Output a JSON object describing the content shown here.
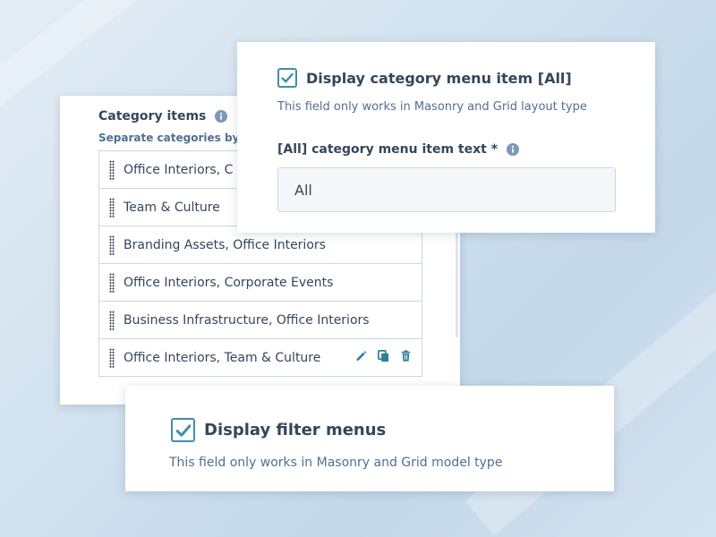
{
  "colors": {
    "checkbox": "#3f8fa9",
    "action_icons": "#2f7f98",
    "heading_text": "#33475b",
    "help_text": "#516f90"
  },
  "category_items": {
    "title": "Category items",
    "title_icon": "info-icon",
    "subtitle": "Separate categories by",
    "rows": [
      {
        "label": "Office Interiors, C"
      },
      {
        "label": "Team & Culture"
      },
      {
        "label": "Branding Assets, Office Interiors"
      },
      {
        "label": "Office Interiors, Corporate Events"
      },
      {
        "label": "Business Infrastructure, Office Interiors"
      },
      {
        "label": "Office Interiors, Team & Culture",
        "actions": [
          "pencil-icon",
          "copy-icon",
          "trash-icon"
        ]
      }
    ]
  },
  "all_menu": {
    "checkbox_checked": true,
    "checkbox_label": "Display category menu item [All]",
    "help_text": "This field only works in Masonry and Grid layout type",
    "field_label": "[All] category menu item text *",
    "field_icon": "info-icon",
    "field_value": "All"
  },
  "filter_menus": {
    "checkbox_checked": true,
    "checkbox_label": "Display filter menus",
    "help_text": "This field only works in Masonry and Grid model type"
  }
}
